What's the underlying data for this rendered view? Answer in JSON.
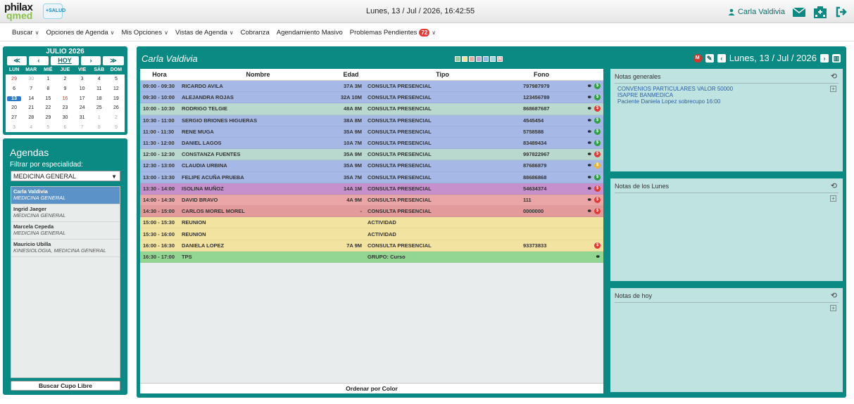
{
  "logo": {
    "text1": "philax",
    "text2": "qmed",
    "text3": "+SALUD"
  },
  "header": {
    "datetime": "Lunes, 13 / Jul / 2026, 16:42:55",
    "user": "Carla Valdivia"
  },
  "menu": [
    {
      "label": "Buscar",
      "chev": "∨"
    },
    {
      "label": "Opciones de Agenda",
      "chev": "∨"
    },
    {
      "label": "Mis Opciones",
      "chev": "∨"
    },
    {
      "label": "Vistas de Agenda",
      "chev": "∨"
    },
    {
      "label": "Cobranza",
      "chev": ""
    },
    {
      "label": "Agendamiento Masivo",
      "chev": ""
    },
    {
      "label": "Problemas Pendientes",
      "chev": "∨",
      "badge": "72"
    }
  ],
  "calendar": {
    "title": "JULIO 2026",
    "buttons": {
      "prev_year": "≪",
      "prev": "‹",
      "today": "HOY",
      "next": "›",
      "next_year": "≫"
    },
    "weekdays": [
      "LUN",
      "MAR",
      "MIÉ",
      "JUE",
      "VIE",
      "SÁB",
      "DOM"
    ],
    "days": [
      {
        "d": "29",
        "c": "d-red d-other"
      },
      {
        "d": "30",
        "c": "d-other"
      },
      {
        "d": "1",
        "c": ""
      },
      {
        "d": "2",
        "c": ""
      },
      {
        "d": "3",
        "c": ""
      },
      {
        "d": "4",
        "c": ""
      },
      {
        "d": "5",
        "c": ""
      },
      {
        "d": "6",
        "c": ""
      },
      {
        "d": "7",
        "c": ""
      },
      {
        "d": "8",
        "c": ""
      },
      {
        "d": "9",
        "c": ""
      },
      {
        "d": "10",
        "c": ""
      },
      {
        "d": "11",
        "c": ""
      },
      {
        "d": "12",
        "c": ""
      },
      {
        "d": "13",
        "c": "d-today"
      },
      {
        "d": "14",
        "c": ""
      },
      {
        "d": "15",
        "c": ""
      },
      {
        "d": "16",
        "c": "d-red"
      },
      {
        "d": "17",
        "c": ""
      },
      {
        "d": "18",
        "c": ""
      },
      {
        "d": "19",
        "c": ""
      },
      {
        "d": "20",
        "c": ""
      },
      {
        "d": "21",
        "c": ""
      },
      {
        "d": "22",
        "c": ""
      },
      {
        "d": "23",
        "c": ""
      },
      {
        "d": "24",
        "c": ""
      },
      {
        "d": "25",
        "c": ""
      },
      {
        "d": "26",
        "c": ""
      },
      {
        "d": "27",
        "c": ""
      },
      {
        "d": "28",
        "c": ""
      },
      {
        "d": "29",
        "c": ""
      },
      {
        "d": "30",
        "c": ""
      },
      {
        "d": "31",
        "c": ""
      },
      {
        "d": "1",
        "c": "d-other"
      },
      {
        "d": "2",
        "c": "d-other"
      },
      {
        "d": "3",
        "c": "d-other"
      },
      {
        "d": "4",
        "c": "d-other"
      },
      {
        "d": "5",
        "c": "d-other"
      },
      {
        "d": "6",
        "c": "d-other"
      },
      {
        "d": "7",
        "c": "d-other"
      },
      {
        "d": "8",
        "c": "d-other"
      },
      {
        "d": "9",
        "c": "d-other"
      }
    ]
  },
  "agendas": {
    "title": "Agendas",
    "filter_label": "Filtrar por especialidad:",
    "selected_specialty": "MEDICINA GENERAL",
    "items": [
      {
        "name": "Carla Valdivia",
        "spec": "MEDICINA GENERAL",
        "selected": true
      },
      {
        "name": "Ingrid Jaeger",
        "spec": "MEDICINA GENERAL",
        "selected": false
      },
      {
        "name": "Marcela Cepeda",
        "spec": "MEDICINA GENERAL",
        "selected": false
      },
      {
        "name": "Mauricio Ubilla",
        "spec": "KINESIOLOGIA, MEDICINA GENERAL",
        "selected": false
      }
    ],
    "search_button": "Buscar Cupo Libre"
  },
  "schedule": {
    "doctor": "Carla Valdivia",
    "date": "Lunes, 13 / Jul / 2026",
    "swatch_colors": [
      "#8fd18f",
      "#f1e29b",
      "#e9a7a7",
      "#c9a1d6",
      "#8fb8ec",
      "#9fd6e8",
      "#e9a7a7"
    ],
    "swatch_letter": "A",
    "columns": {
      "hora": "Hora",
      "nombre": "Nombre",
      "edad": "Edad",
      "tipo": "Tipo",
      "fono": "Fono"
    },
    "rows": [
      {
        "hora": "09:00 - 09:30",
        "nombre": "RICARDO AVILA",
        "edad": "37A 3M",
        "tipo": "CONSULTA PRESENCIAL",
        "fono": "797987979",
        "color": "#a5b8e6",
        "link": true,
        "dot": "$",
        "dotc": "#2ea043"
      },
      {
        "hora": "09:30 - 10:00",
        "nombre": "ALEJANDRA ROJAS",
        "edad": "32A 10M",
        "tipo": "CONSULTA PRESENCIAL",
        "fono": "123456789",
        "color": "#a5b8e6",
        "link": true,
        "dot": "$",
        "dotc": "#2ea043"
      },
      {
        "hora": "10:00 - 10:30",
        "nombre": "RODRIGO TELGIE",
        "edad": "48A 8M",
        "tipo": "CONSULTA PRESENCIAL",
        "fono": "868687687",
        "color": "#b9d9cf",
        "link": true,
        "dot": "$",
        "dotc": "#e53935"
      },
      {
        "hora": "10:30 - 11:00",
        "nombre": "SERGIO BRIONES HIGUERAS",
        "edad": "38A 8M",
        "tipo": "CONSULTA PRESENCIAL",
        "fono": "4545454",
        "color": "#a5b8e6",
        "link": true,
        "dot": "$",
        "dotc": "#2ea043"
      },
      {
        "hora": "11:00 - 11:30",
        "nombre": "RENE MUGA",
        "edad": "35A 9M",
        "tipo": "CONSULTA PRESENCIAL",
        "fono": "5758588",
        "color": "#a5b8e6",
        "link": true,
        "dot": "$",
        "dotc": "#2ea043"
      },
      {
        "hora": "11:30 - 12:00",
        "nombre": "DANIEL LAGOS",
        "edad": "10A 7M",
        "tipo": "CONSULTA PRESENCIAL",
        "fono": "83489434",
        "color": "#a5b8e6",
        "link": true,
        "dot": "$",
        "dotc": "#2ea043"
      },
      {
        "hora": "12:00 - 12:30",
        "nombre": "CONSTANZA FUENTES",
        "edad": "35A 9M",
        "tipo": "CONSULTA PRESENCIAL",
        "fono": "997822967",
        "color": "#b9d9cf",
        "link": true,
        "dot": "$",
        "dotc": "#e53935"
      },
      {
        "hora": "12:30 - 13:00",
        "nombre": "CLAUDIA URBINA",
        "edad": "35A 9M",
        "tipo": "CONSULTA PRESENCIAL",
        "fono": "87686879",
        "color": "#a5b8e6",
        "link": true,
        "dot": "$",
        "dotc": "#f0b429"
      },
      {
        "hora": "13:00 - 13:30",
        "nombre": "FELIPE ACUÑA PRUEBA",
        "edad": "35A 7M",
        "tipo": "CONSULTA PRESENCIAL",
        "fono": "88686868",
        "color": "#a5b8e6",
        "link": true,
        "dot": "$",
        "dotc": "#2ea043"
      },
      {
        "hora": "13:30 - 14:00",
        "nombre": "ISOLINA MUÑOZ",
        "edad": "14A 1M",
        "tipo": "CONSULTA PRESENCIAL",
        "fono": "54634374",
        "color": "#c690cc",
        "link": true,
        "dot": "$",
        "dotc": "#e53935"
      },
      {
        "hora": "14:00 - 14:30",
        "nombre": "DAVID BRAVO",
        "edad": "4A 9M",
        "tipo": "CONSULTA PRESENCIAL",
        "fono": "111",
        "color": "#eaa6a6",
        "link": true,
        "dot": "$",
        "dotc": "#e53935"
      },
      {
        "hora": "14:30 - 15:00",
        "nombre": "CARLOS MOREL MOREL",
        "edad": "-",
        "tipo": "CONSULTA PRESENCIAL",
        "fono": "0000000",
        "color": "#e29a9a",
        "link": true,
        "dot": "$",
        "dotc": "#e53935"
      },
      {
        "hora": "15:00 - 15:30",
        "nombre": "REUNION",
        "edad": "",
        "tipo": "ACTIVIDAD",
        "fono": "",
        "color": "#f3e3a1",
        "link": false,
        "dot": "",
        "dotc": ""
      },
      {
        "hora": "15:30 - 16:00",
        "nombre": "REUNION",
        "edad": "",
        "tipo": "ACTIVIDAD",
        "fono": "",
        "color": "#f3e3a1",
        "link": false,
        "dot": "",
        "dotc": ""
      },
      {
        "hora": "16:00 - 16:30",
        "nombre": "DANIELA LOPEZ",
        "edad": "7A 9M",
        "tipo": "CONSULTA PRESENCIAL",
        "fono": "93373833",
        "color": "#f3e3a1",
        "link": false,
        "dot": "$",
        "dotc": "#e53935"
      },
      {
        "hora": "16:30 - 17:00",
        "nombre": "TPS",
        "edad": "",
        "tipo": "GRUPO: Curso",
        "fono": "",
        "color": "#93d593",
        "link": true,
        "dot": "",
        "dotc": ""
      }
    ],
    "footer": "Ordenar por Color"
  },
  "notes": [
    {
      "title": "Notas generales",
      "lines": [
        "CONVENIOS PARTICULARES VALOR 50000",
        "ISAPRE BANMEDICA",
        "Paciente Daniela Lopez sobrecupo 16:00"
      ]
    },
    {
      "title": "Notas de los Lunes",
      "lines": []
    },
    {
      "title": "Notas de hoy",
      "lines": []
    }
  ],
  "colors": {
    "teal": "#0a8a82",
    "note_bg": "#bfe3e1"
  }
}
